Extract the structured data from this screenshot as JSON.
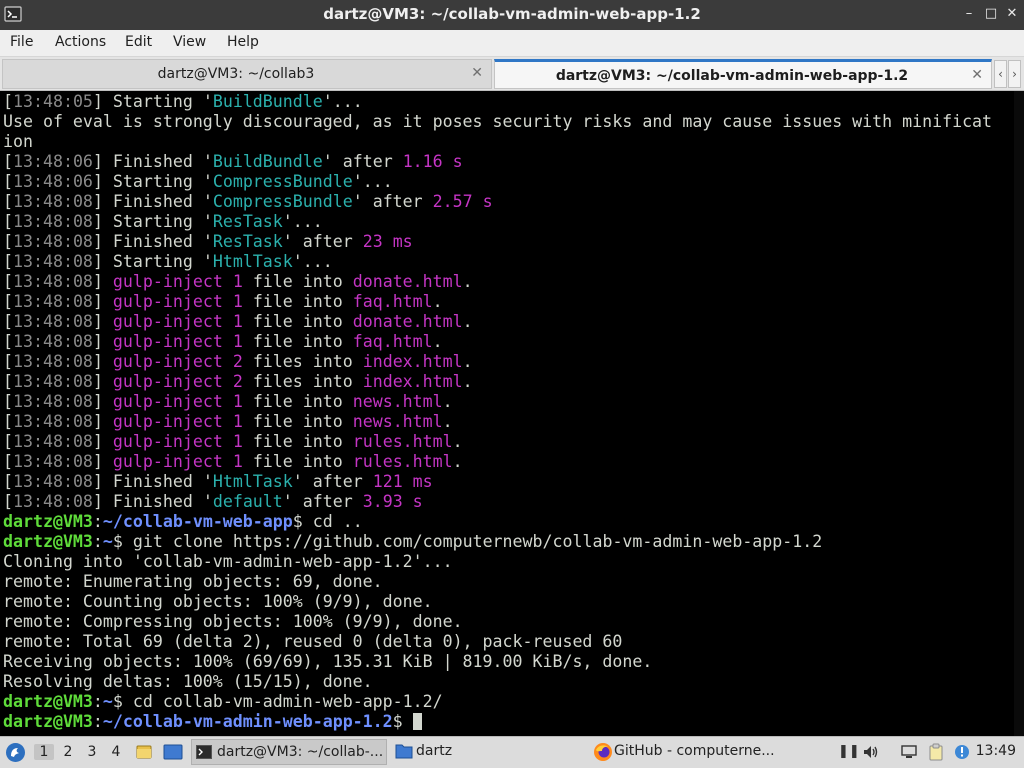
{
  "window": {
    "title": "dartz@VM3: ~/collab-vm-admin-web-app-1.2",
    "minimize_glyph": "–",
    "maximize_glyph": "□",
    "close_glyph": "✕"
  },
  "menu": {
    "file": "File",
    "actions": "Actions",
    "edit": "Edit",
    "view": "View",
    "help": "Help"
  },
  "tabs": [
    {
      "label": "dartz@VM3: ~/collab3",
      "close": "✕"
    },
    {
      "label": "dartz@VM3: ~/collab-vm-admin-web-app-1.2",
      "close": "✕"
    }
  ],
  "tab_scroll": {
    "left": "‹",
    "right": "›"
  },
  "terminal": {
    "gulp": [
      {
        "ts": "13:48:05",
        "pre": " Starting '",
        "name": "BuildBundle",
        "post": "'..."
      },
      {
        "text": "Use of eval is strongly discouraged, as it poses security risks and may cause issues with minificat"
      },
      {
        "text": "ion"
      },
      {
        "ts": "13:48:06",
        "pre": " Finished '",
        "name": "BuildBundle",
        "post": "' after ",
        "time": "1.16 s"
      },
      {
        "ts": "13:48:06",
        "pre": " Starting '",
        "name": "CompressBundle",
        "post": "'..."
      },
      {
        "ts": "13:48:08",
        "pre": " Finished '",
        "name": "CompressBundle",
        "post": "' after ",
        "time": "2.57 s"
      },
      {
        "ts": "13:48:08",
        "pre": " Starting '",
        "name": "ResTask",
        "post": "'..."
      },
      {
        "ts": "13:48:08",
        "pre": " Finished '",
        "name": "ResTask",
        "post": "' after ",
        "time": "23 ms"
      },
      {
        "ts": "13:48:08",
        "pre": " Starting '",
        "name": "HtmlTask",
        "post": "'..."
      },
      {
        "ts": "13:48:08",
        "inject": "gulp-inject",
        "n": "1",
        "word": " file into ",
        "file": "donate.html",
        "end": "."
      },
      {
        "ts": "13:48:08",
        "inject": "gulp-inject",
        "n": "1",
        "word": " file into ",
        "file": "faq.html",
        "end": "."
      },
      {
        "ts": "13:48:08",
        "inject": "gulp-inject",
        "n": "1",
        "word": " file into ",
        "file": "donate.html",
        "end": "."
      },
      {
        "ts": "13:48:08",
        "inject": "gulp-inject",
        "n": "1",
        "word": " file into ",
        "file": "faq.html",
        "end": "."
      },
      {
        "ts": "13:48:08",
        "inject": "gulp-inject",
        "n": "2",
        "word": " files into ",
        "file": "index.html",
        "end": "."
      },
      {
        "ts": "13:48:08",
        "inject": "gulp-inject",
        "n": "2",
        "word": " files into ",
        "file": "index.html",
        "end": "."
      },
      {
        "ts": "13:48:08",
        "inject": "gulp-inject",
        "n": "1",
        "word": " file into ",
        "file": "news.html",
        "end": "."
      },
      {
        "ts": "13:48:08",
        "inject": "gulp-inject",
        "n": "1",
        "word": " file into ",
        "file": "news.html",
        "end": "."
      },
      {
        "ts": "13:48:08",
        "inject": "gulp-inject",
        "n": "1",
        "word": " file into ",
        "file": "rules.html",
        "end": "."
      },
      {
        "ts": "13:48:08",
        "inject": "gulp-inject",
        "n": "1",
        "word": " file into ",
        "file": "rules.html",
        "end": "."
      },
      {
        "ts": "13:48:08",
        "pre": " Finished '",
        "name": "HtmlTask",
        "post": "' after ",
        "time": "121 ms"
      },
      {
        "ts": "13:48:08",
        "pre": " Finished '",
        "name": "default",
        "post": "' after ",
        "time": "3.93 s"
      }
    ],
    "prompt_user": "dartz@VM3",
    "path_webapp": "~/collab-vm-web-app",
    "cmd1": " cd ..",
    "path_tilde": "~",
    "cmd2": " git clone https://github.com/computernewb/collab-vm-admin-web-app-1.2",
    "output": [
      "Cloning into 'collab-vm-admin-web-app-1.2'...",
      "remote: Enumerating objects: 69, done.",
      "remote: Counting objects: 100% (9/9), done.",
      "remote: Compressing objects: 100% (9/9), done.",
      "remote: Total 69 (delta 2), reused 0 (delta 0), pack-reused 60",
      "Receiving objects: 100% (69/69), 135.31 KiB | 819.00 KiB/s, done.",
      "Resolving deltas: 100% (15/15), done."
    ],
    "cmd3": " cd collab-vm-admin-web-app-1.2/",
    "path_admin": "~/collab-vm-admin-web-app-1.2"
  },
  "taskbar": {
    "workspaces": [
      "1",
      "2",
      "3",
      "4"
    ],
    "tasks": [
      {
        "label": "dartz@VM3: ~/collab-..."
      },
      {
        "label": "dartz"
      },
      {
        "label": "GitHub - computerne..."
      }
    ],
    "clock": "13:49"
  }
}
